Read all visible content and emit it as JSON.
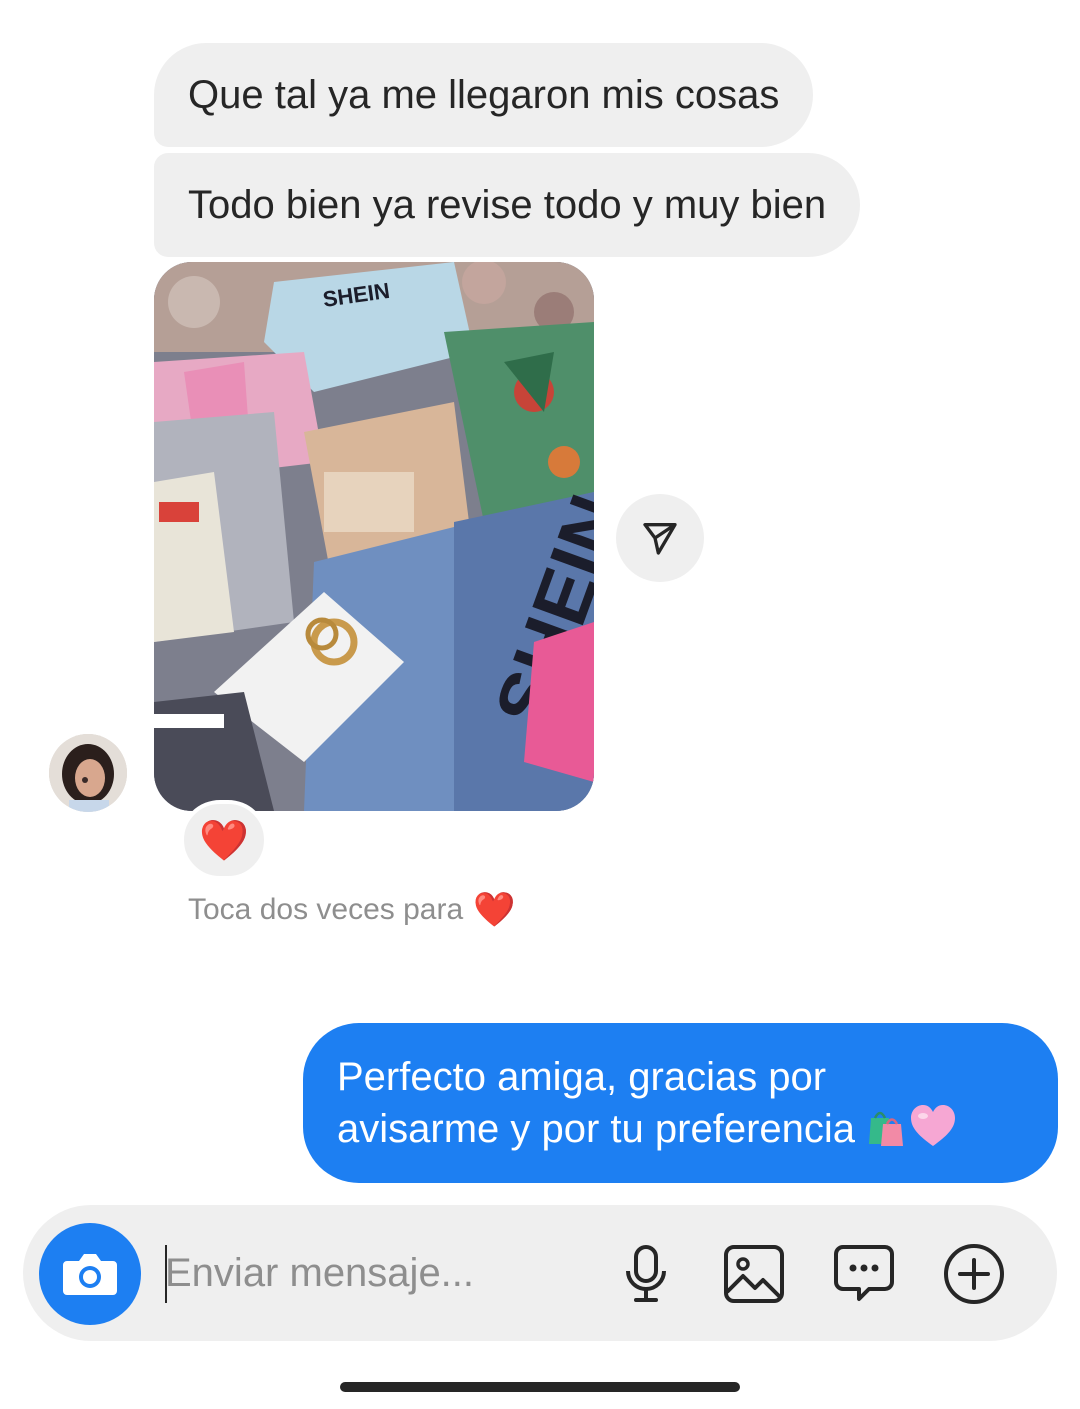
{
  "thread": {
    "incoming": [
      {
        "text": "Que tal ya me llegaron mis cosas"
      },
      {
        "text": "Todo bien ya revise todo y muy bien"
      }
    ],
    "photo_reaction": "❤️",
    "hint_text": "Toca dos veces para",
    "hint_heart": "❤️",
    "outgoing": {
      "line1": "Perfecto amiga, gracias por",
      "line2": "avisarme y por tu preferencia"
    }
  },
  "composer": {
    "placeholder": "Enviar mensaje..."
  },
  "icons": {
    "share": "paper-plane-icon",
    "camera": "camera-icon",
    "mic": "microphone-icon",
    "gallery": "image-icon",
    "sticker": "chat-bubble-icon",
    "more": "plus-circle-icon"
  },
  "colors": {
    "incoming_bubble": "#efefef",
    "outgoing_bubble": "#1d7ff2",
    "reaction_heart": "#e0202b"
  }
}
